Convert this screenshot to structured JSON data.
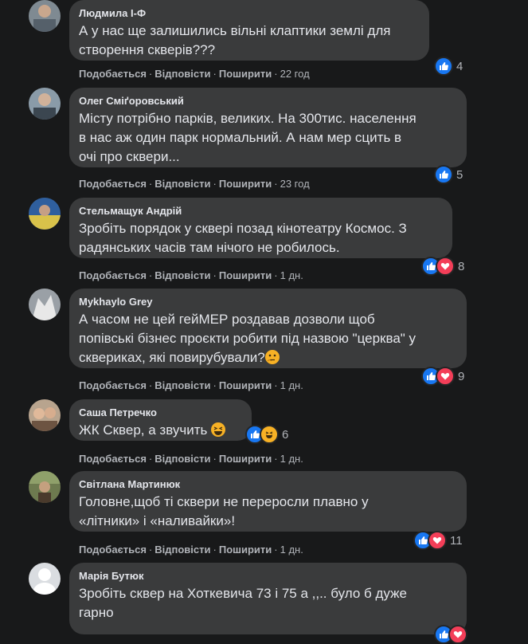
{
  "actions": {
    "like": "Подобається",
    "reply": "Відповісти",
    "share": "Поширити",
    "dot": "·"
  },
  "comments": [
    {
      "author": "Людмила І-Ф",
      "lines": [
        "А у нас ще залишились вільні клаптики землі для",
        "створення скверів???"
      ],
      "time": "22 год",
      "reactions": [
        "like"
      ],
      "count": "4"
    },
    {
      "author": "Олег Сміґоровський",
      "lines": [
        "Місту потрібно парків, великих. На 300тис. населення",
        "в нас аж один парк нормальний. А нам мер сцить в",
        "очі про сквери..."
      ],
      "time": "23 год",
      "reactions": [
        "like"
      ],
      "count": "5"
    },
    {
      "author": "Стельмащук Андрій",
      "lines": [
        "Зробіть порядок у сквері позад кінотеатру Космос. З",
        "радянських часів там нічого не робилось."
      ],
      "time": "1 дн.",
      "reactions": [
        "like",
        "love"
      ],
      "count": "8"
    },
    {
      "author": "Mykhaylo Grey",
      "lines": [
        "А часом не цей гейМЕР роздавав дозволи щоб",
        "попівські бізнес проєкти робити під назвою \"церква\" у",
        "сквериках, які повирубували?"
      ],
      "time": "1 дн.",
      "reactions": [
        "like",
        "love"
      ],
      "count": "9",
      "emoji": "thinking"
    },
    {
      "author": "Саша Петречко",
      "lines": [
        "ЖК Сквер, а звучить"
      ],
      "time": "1 дн.",
      "reactions": [
        "like",
        "haha"
      ],
      "count": "6",
      "emoji": "laughing"
    },
    {
      "author": "Світлана Мартинюк",
      "lines": [
        "Головне,щоб ті сквери не переросли плавно у",
        "«літники» і «наливайки»!"
      ],
      "time": "1 дн.",
      "reactions": [
        "like",
        "love"
      ],
      "count": "11"
    },
    {
      "author": "Марія Бутюк",
      "lines": [
        "Зробіть сквер на Хоткевича 73 і 75 а ,,.. було б дуже",
        "гарно"
      ],
      "time": "",
      "reactions": [
        "like",
        "love"
      ],
      "count": ""
    }
  ],
  "colors": {
    "like": "#1877f2",
    "love": "#f33e58",
    "haha": "#f7b125"
  }
}
